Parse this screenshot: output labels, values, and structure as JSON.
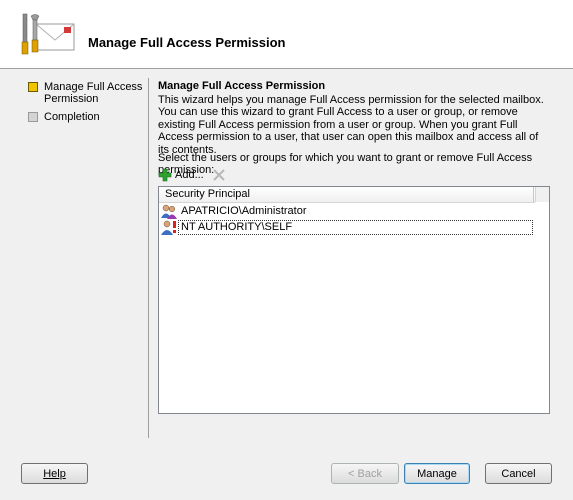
{
  "header": {
    "title": "Manage Full Access Permission"
  },
  "sidebar": {
    "items": [
      {
        "label": "Manage Full Access Permission",
        "state": "active"
      },
      {
        "label": "Completion",
        "state": "inactive"
      }
    ]
  },
  "content": {
    "title": "Manage Full Access Permission",
    "description": "This wizard helps you manage Full Access permission for the selected mailbox. You can use this wizard to grant Full Access to a user or group, or remove existing Full Access permission from a user or group. When you grant Full Access permission to a user, that user can open this mailbox and access all of its contents.",
    "select_label": "Select the users or groups for which you want to grant or remove Full Access permission:",
    "add_label": "Add..."
  },
  "list": {
    "column": "Security Principal",
    "rows": [
      {
        "name": "APATRICIO\\Administrator",
        "icon": "users-group-icon"
      },
      {
        "name": "NT AUTHORITY\\SELF",
        "icon": "user-denied-icon",
        "selected": true
      }
    ]
  },
  "buttons": {
    "help": "Help",
    "back": "< Back",
    "manage": "Manage",
    "cancel": "Cancel"
  },
  "colors": {
    "active_step": "#f2c400",
    "add_green": "#2fa12f"
  }
}
